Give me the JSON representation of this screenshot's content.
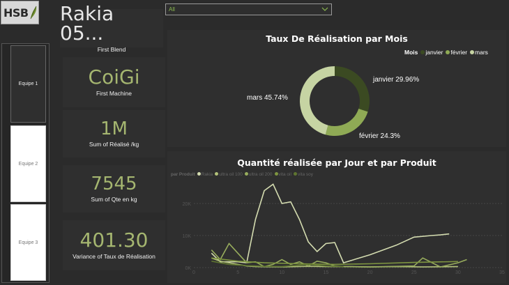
{
  "logo": {
    "text": "HSB"
  },
  "filter": {
    "selected": "All"
  },
  "teams": [
    {
      "label": "Equipe 1"
    },
    {
      "label": "Equipe 2"
    },
    {
      "label": "Equipe 3"
    }
  ],
  "cards": {
    "blend": {
      "value": "Rakia 05...",
      "caption": "First Blend"
    },
    "machine": {
      "value": "CoiGi",
      "caption": "First Machine"
    },
    "realise": {
      "value": "1M",
      "caption": "Sum of Réalisé /kg"
    },
    "qte": {
      "value": "7545",
      "caption": "Sum of Qte en kg"
    },
    "variance": {
      "value": "401.30",
      "caption": "Variance of Taux de Réalisation"
    }
  },
  "colors": {
    "accent": "#a5b670",
    "janvier": "#3b4a22",
    "fevrier": "#8faa55",
    "mars": "#c6d4a3"
  },
  "chart_data": [
    {
      "type": "pie",
      "title": "Taux De Réalisation par Mois",
      "legend_title": "Mois",
      "legend_position": "top-right",
      "labels": [
        "janvier",
        "février",
        "mars"
      ],
      "values": [
        29.96,
        24.3,
        45.74
      ],
      "data_labels": [
        "janvier 29.96%",
        "février 24.3%",
        "mars 45.74%"
      ]
    },
    {
      "type": "line",
      "title": "Quantité réalisée par Jour et par Produit",
      "legend_title": "par Produit",
      "legend_position": "top-left",
      "xlim": [
        0,
        35
      ],
      "ylim": [
        0,
        20000
      ],
      "x_ticks": [
        "0",
        "5",
        "10",
        "15",
        "20",
        "25",
        "30",
        "35"
      ],
      "y_ticks": [
        "0K",
        "10K",
        "20K"
      ],
      "series": [
        {
          "name": "Rakia",
          "color": "#d4dcb0",
          "points": [
            [
              2,
              4500
            ],
            [
              3,
              1800
            ],
            [
              5,
              1800
            ],
            [
              6,
              1500
            ],
            [
              7,
              15000
            ],
            [
              8,
              24000
            ],
            [
              9,
              26000
            ],
            [
              10,
              20000
            ],
            [
              11,
              20500
            ],
            [
              12,
              15000
            ],
            [
              13,
              8000
            ],
            [
              14,
              5000
            ],
            [
              15,
              7500
            ],
            [
              16,
              7800
            ],
            [
              17,
              1500
            ],
            [
              20,
              4000
            ],
            [
              23,
              7000
            ],
            [
              25,
              9500
            ],
            [
              27,
              10000
            ],
            [
              28,
              10200
            ],
            [
              29,
              10500
            ]
          ]
        },
        {
          "name": "ultra oil 100",
          "color": "#b3c27a",
          "points": [
            [
              2,
              3000
            ],
            [
              3,
              2000
            ],
            [
              4,
              1500
            ],
            [
              5,
              1000
            ],
            [
              6,
              500
            ],
            [
              7,
              300
            ],
            [
              10,
              200
            ],
            [
              13,
              400
            ],
            [
              15,
              300
            ],
            [
              18,
              300
            ],
            [
              20,
              200
            ],
            [
              23,
              300
            ],
            [
              26,
              200
            ],
            [
              30,
              300
            ]
          ]
        },
        {
          "name": "ultra oil 200",
          "color": "#98ad5d",
          "points": [
            [
              2,
              5500
            ],
            [
              3,
              2500
            ],
            [
              4,
              7500
            ],
            [
              5,
              4500
            ],
            [
              6,
              1500
            ],
            [
              7,
              1800
            ],
            [
              8,
              300
            ],
            [
              9,
              1000
            ],
            [
              10,
              2500
            ],
            [
              11,
              1000
            ],
            [
              12,
              1800
            ],
            [
              13,
              500
            ],
            [
              14,
              2000
            ],
            [
              15,
              1500
            ],
            [
              16,
              500
            ],
            [
              17,
              300
            ],
            [
              20,
              200
            ],
            [
              25,
              500
            ],
            [
              26,
              3000
            ],
            [
              28,
              200
            ],
            [
              30,
              1500
            ],
            [
              31,
              2500
            ]
          ]
        },
        {
          "name": "vita oil",
          "color": "#7e9540",
          "points": [
            [
              2,
              3000
            ],
            [
              5,
              2000
            ],
            [
              8,
              1500
            ],
            [
              12,
              1200
            ],
            [
              16,
              1000
            ],
            [
              20,
              1200
            ],
            [
              25,
              1600
            ],
            [
              30,
              1900
            ]
          ]
        },
        {
          "name": "vita soy",
          "color": "#5f7530",
          "points": [
            [
              2,
              2000
            ],
            [
              4,
              1000
            ],
            [
              6,
              600
            ],
            [
              8,
              400
            ],
            [
              10,
              300
            ],
            [
              13,
              1000
            ],
            [
              15,
              500
            ],
            [
              17,
              300
            ]
          ]
        }
      ]
    }
  ]
}
